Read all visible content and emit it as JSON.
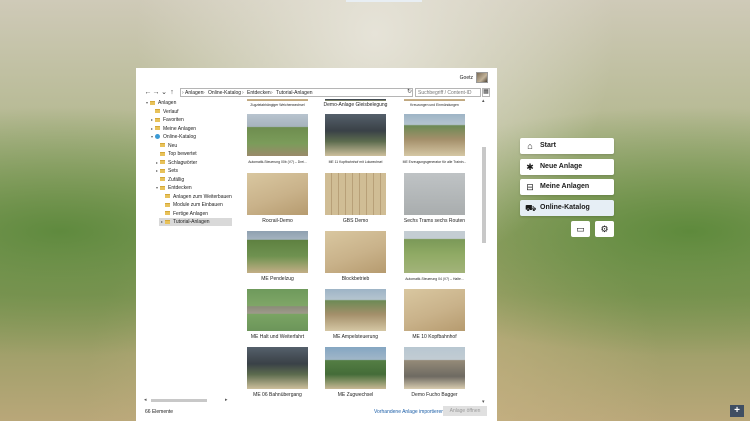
{
  "dialog": {
    "user": "Goetz",
    "breadcrumbs": [
      "Anlagen",
      "Online-Katalog",
      "Entdecken",
      "Tutorial-Anlagen"
    ],
    "search_placeholder": "Suchbegriff / Content-ID",
    "status_count": "66 Elemente",
    "import_link": "Vorhandene Anlage importieren",
    "open_button": "Anlage öffnen"
  },
  "tree": [
    {
      "label": "Anlagen",
      "level": 0,
      "expanded": true
    },
    {
      "label": "Verlauf",
      "level": 1
    },
    {
      "label": "Favoriten",
      "level": 1,
      "collapsed": true
    },
    {
      "label": "Meine Anlagen",
      "level": 1,
      "collapsed": true
    },
    {
      "label": "Online-Katalog",
      "level": 1,
      "expanded": true
    },
    {
      "label": "Neu",
      "level": 2
    },
    {
      "label": "Top bewertet",
      "level": 2
    },
    {
      "label": "Schlagwörter",
      "level": 2,
      "collapsed": true
    },
    {
      "label": "Sets",
      "level": 2,
      "collapsed": true
    },
    {
      "label": "Zufällig",
      "level": 2
    },
    {
      "label": "Entdecken",
      "level": 2,
      "expanded": true
    },
    {
      "label": "Anlagen zum Weiterbauen",
      "level": 3
    },
    {
      "label": "Module zum Einbauen",
      "level": 3
    },
    {
      "label": "Fertige Anlagen",
      "level": 3
    },
    {
      "label": "Tutorial-Anlagen",
      "level": 3,
      "collapsed": true,
      "selected": true
    }
  ],
  "top_captions": [
    "Zugzielabhängiger Weichenwechsel",
    "Demo-Anlage Gleisbelegung",
    "Kreuzungen und Einmündungen"
  ],
  "tiles": [
    {
      "caption": "Automatik-Steuerung 00b (V7) – Drei...",
      "size": "small",
      "thumb": "grass"
    },
    {
      "caption": "ME 11 Kopfbahnhof mit Lokwechsel",
      "size": "small",
      "thumb": "dark"
    },
    {
      "caption": "ME Erzeugungsgenerator für alle Trainin...",
      "size": "small",
      "thumb": "town"
    },
    {
      "caption": "Rocrail-Demo",
      "size": "big",
      "thumb": "sand"
    },
    {
      "caption": "GBS Demo",
      "size": "big",
      "thumb": "sand2"
    },
    {
      "caption": "Sechs Trams sechs Routen",
      "size": "big",
      "thumb": "grey"
    },
    {
      "caption": "ME Pendelzug",
      "size": "big",
      "thumb": "grass2"
    },
    {
      "caption": "Blockbetrieb",
      "size": "big",
      "thumb": "sand"
    },
    {
      "caption": "Automatik-Steuerung 04 (V7) – Halte...",
      "size": "small",
      "thumb": "field"
    },
    {
      "caption": "ME Halt und Weiterfahrt",
      "size": "big",
      "thumb": "rail"
    },
    {
      "caption": "ME Ampelsteuerung",
      "size": "big",
      "thumb": "town"
    },
    {
      "caption": "ME 10 Kopfbahnhof",
      "size": "big",
      "thumb": "sand"
    },
    {
      "caption": "ME 06 Bahnübergang",
      "size": "big",
      "thumb": "dark"
    },
    {
      "caption": "ME Zugwechsel",
      "size": "big",
      "thumb": "lake"
    },
    {
      "caption": "Demo Fucho Bagger",
      "size": "big",
      "thumb": "station"
    }
  ],
  "menu": [
    {
      "label": "Start",
      "icon": "home-icon",
      "glyph": "⌂",
      "active": false
    },
    {
      "label": "Neue Anlage",
      "icon": "new-layout-icon",
      "glyph": "✱",
      "active": false
    },
    {
      "label": "Meine Anlagen",
      "icon": "train-icon",
      "glyph": "⊟",
      "active": false
    },
    {
      "label": "Online-Katalog",
      "icon": "catalog-icon",
      "glyph": "⛟",
      "active": true
    }
  ],
  "icons": {
    "back": "←",
    "forward": "→",
    "down": "⌄",
    "up": "↑",
    "refresh": "↻",
    "grid_view": "▦",
    "chat": "▭",
    "settings": "⚙",
    "add": "+"
  }
}
